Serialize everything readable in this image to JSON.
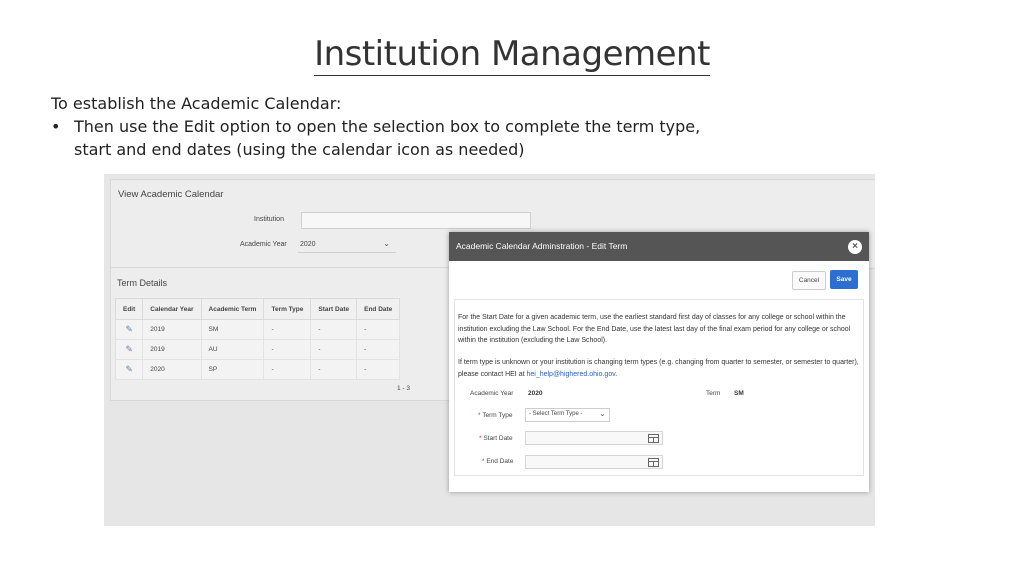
{
  "slide": {
    "title": "Institution Management",
    "intro": "To establish the Academic Calendar:",
    "bullet_char": "•",
    "bullet_text": "Then use the Edit option to open the selection box to complete the term type, start and end dates (using the calendar icon as needed)"
  },
  "view_panel": {
    "title": "View Academic Calendar",
    "institution_label": "Institution",
    "institution_value": "",
    "academic_year_label": "Academic Year",
    "academic_year_value": "2020"
  },
  "term_details": {
    "title": "Term Details",
    "columns": [
      "Edit",
      "Calendar Year",
      "Academic Term",
      "Term Type",
      "Start Date",
      "End Date"
    ],
    "rows": [
      {
        "calendar_year": "2019",
        "academic_term": "SM",
        "term_type": "-",
        "start_date": "-",
        "end_date": "-"
      },
      {
        "calendar_year": "2019",
        "academic_term": "AU",
        "term_type": "-",
        "start_date": "-",
        "end_date": "-"
      },
      {
        "calendar_year": "2020",
        "academic_term": "SP",
        "term_type": "-",
        "start_date": "-",
        "end_date": "-"
      }
    ],
    "pagination": "1 - 3"
  },
  "modal": {
    "title": "Academic Calendar Adminstration - Edit Term",
    "close_symbol": "×",
    "cancel_label": "Cancel",
    "save_label": "Save",
    "info_paragraph_1": "For the Start Date for a given academic term, use the earliest standard first day of classes for any college or school within the institution excluding the Law School. For the End Date, use the latest last day of the final exam period for any college or school within the institution (excluding the Law School).",
    "info_paragraph_2_prefix": "If term type is unknown or your institution is changing term types (e.g. changing from quarter to semester, or semester to quarter), please contact HEI at ",
    "info_paragraph_2_link": "hei_help@highered.ohio.gov",
    "info_paragraph_2_suffix": ".",
    "academic_year_label": "Academic Year",
    "academic_year_value": "2020",
    "term_label": "Term",
    "term_value": "SM",
    "required_marker": "*",
    "term_type_label": "Term Type",
    "term_type_placeholder": "- Select Term Type -",
    "start_date_label": "Start Date",
    "start_date_value": "",
    "end_date_label": "End Date",
    "end_date_value": ""
  },
  "icons": {
    "edit": "pencil-edit-icon",
    "calendar": "calendar-icon",
    "chevron": "chevron-down-icon",
    "close": "close-icon"
  },
  "colors": {
    "modal_header": "#555555",
    "save_button": "#2d6fd1",
    "link": "#2a5fb8",
    "required": "#dd2233"
  }
}
